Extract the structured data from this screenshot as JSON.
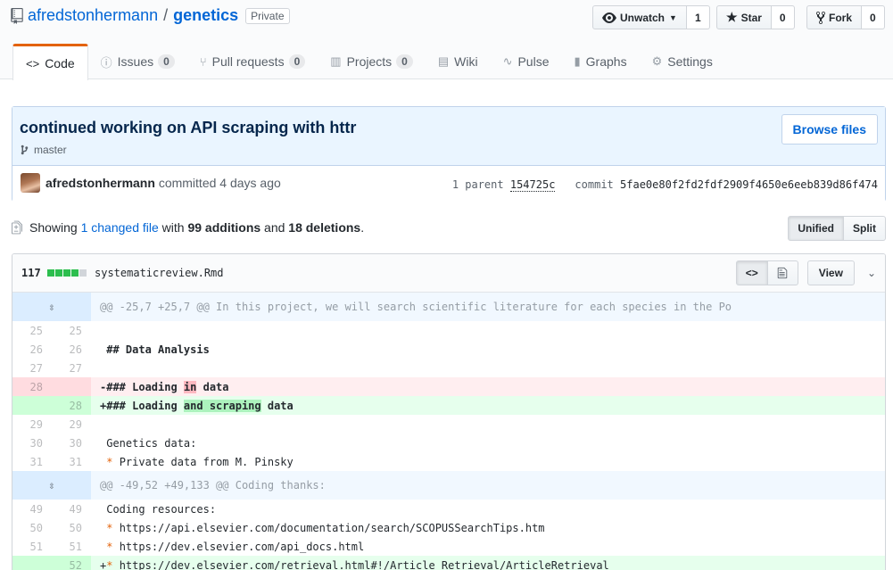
{
  "repo": {
    "owner": "afredstonhermann",
    "name": "genetics",
    "visibility": "Private"
  },
  "actions": {
    "watch_label": "Unwatch",
    "watch_count": "1",
    "star_label": "Star",
    "star_count": "0",
    "fork_label": "Fork",
    "fork_count": "0"
  },
  "tabs": [
    {
      "label": "Code"
    },
    {
      "label": "Issues",
      "count": "0"
    },
    {
      "label": "Pull requests",
      "count": "0"
    },
    {
      "label": "Projects",
      "count": "0"
    },
    {
      "label": "Wiki"
    },
    {
      "label": "Pulse"
    },
    {
      "label": "Graphs"
    },
    {
      "label": "Settings"
    }
  ],
  "commit": {
    "title": "continued working on API scraping with httr",
    "branch": "master",
    "browse_label": "Browse files",
    "author": "afredstonhermann",
    "committed_text": "committed 4 days ago",
    "parent_label": "1 parent",
    "parent_sha": "154725c",
    "commit_label": "commit",
    "commit_sha": "5fae0e80f2fd2fdf2909f4650e6eeb839d86f474"
  },
  "toc": {
    "showing": "Showing",
    "changed": "1 changed file",
    "with": "with",
    "additions": "99 additions",
    "and": "and",
    "deletions": "18 deletions",
    "period": ".",
    "unified": "Unified",
    "split": "Split"
  },
  "file": {
    "changes": "117",
    "filename": "systematicreview.Rmd",
    "view_label": "View",
    "lines": [
      {
        "type": "hunk",
        "text": "@@ -25,7 +25,7 @@ In this project, we will search scientific literature for each species in the Po"
      },
      {
        "type": "ctx",
        "old": "25",
        "new": "25",
        "text": " "
      },
      {
        "type": "ctx",
        "old": "26",
        "new": "26",
        "text": " ## Data Analysis"
      },
      {
        "type": "ctx",
        "old": "27",
        "new": "27",
        "text": " "
      },
      {
        "type": "del",
        "old": "28",
        "new": "",
        "pre": "-### Loading ",
        "hl": "in",
        "post": " data"
      },
      {
        "type": "add",
        "old": "",
        "new": "28",
        "pre": "+### Loading ",
        "hl": "and scraping",
        "post": " data"
      },
      {
        "type": "ctx",
        "old": "29",
        "new": "29",
        "text": " "
      },
      {
        "type": "ctx",
        "old": "30",
        "new": "30",
        "text": " Genetics data:"
      },
      {
        "type": "bul",
        "old": "31",
        "new": "31",
        "pre": " ",
        "mark": "*",
        "post": " Private data from M. Pinsky"
      },
      {
        "type": "hunk",
        "text": "@@ -49,52 +49,133 @@ Coding thanks:"
      },
      {
        "type": "ctx",
        "old": "49",
        "new": "49",
        "text": " Coding resources:"
      },
      {
        "type": "bul",
        "old": "50",
        "new": "50",
        "pre": " ",
        "mark": "*",
        "post": " https://api.elsevier.com/documentation/search/SCOPUSSearchTips.htm"
      },
      {
        "type": "bul",
        "old": "51",
        "new": "51",
        "pre": " ",
        "mark": "*",
        "post": " https://dev.elsevier.com/api_docs.html"
      },
      {
        "type": "addbul",
        "old": "",
        "new": "52",
        "pre": "+",
        "mark": "*",
        "post": " https://dev.elsevier.com/retrieval.html#!/Article_Retrieval/ArticleRetrieval"
      }
    ]
  }
}
